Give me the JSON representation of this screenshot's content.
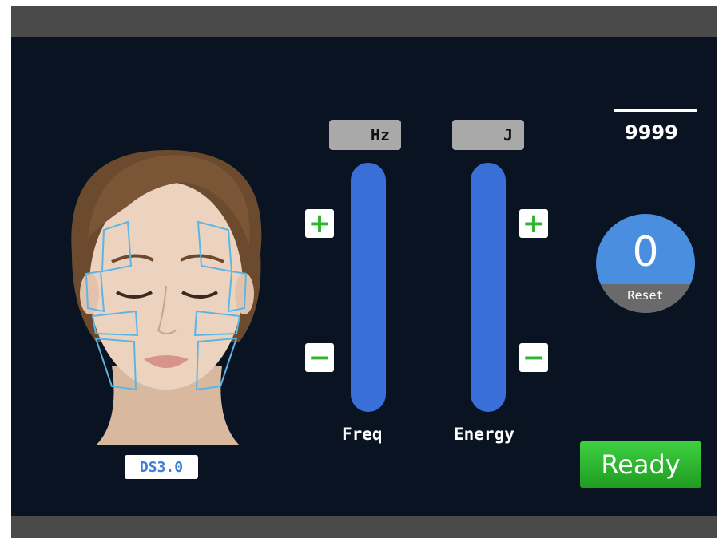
{
  "device": {
    "model_label": "DS3.0"
  },
  "freq": {
    "unit": "Hz",
    "label": "Freq",
    "plus": "+",
    "minus": "−"
  },
  "energy": {
    "unit": "J",
    "label": "Energy",
    "plus": "+",
    "minus": "−"
  },
  "counter": {
    "value": "9999"
  },
  "reset": {
    "value": "0",
    "label": "Reset"
  },
  "ready": {
    "label": "Ready"
  },
  "colors": {
    "background": "#0a1322",
    "slider": "#3b6fd8",
    "accent_green": "#2fb52f",
    "dial_blue": "#4a8ee0"
  },
  "icons": {
    "plus": "plus-icon",
    "minus": "minus-icon"
  }
}
